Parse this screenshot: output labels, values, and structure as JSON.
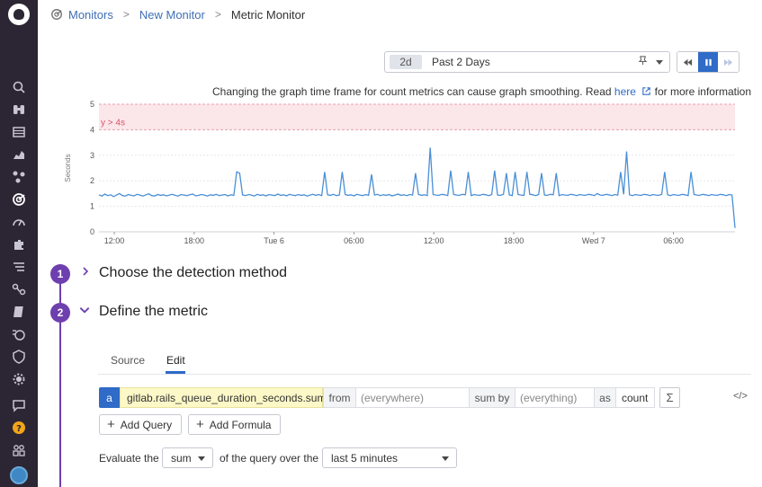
{
  "sidebar": {
    "icons": [
      "datadog-logo-icon",
      "search-icon",
      "binoculars-icon",
      "dashboard-icon",
      "chart-icon",
      "infrastructure-icon",
      "monitors-icon",
      "apm-gauge-icon",
      "integrations-icon",
      "logs-icon",
      "network-icon",
      "notebook-icon",
      "synthetics-icon",
      "security-icon",
      "settings-gear-icon",
      "chat-icon",
      "help-icon",
      "teams-icon",
      "user-avatar"
    ]
  },
  "breadcrumb": {
    "items": [
      "Monitors",
      "New Monitor",
      "Metric Monitor"
    ],
    "separator": ">"
  },
  "timeframe": {
    "badge": "2d",
    "label": "Past 2 Days"
  },
  "notice": {
    "before": "Changing the graph time frame for count metrics can cause graph smoothing. Read ",
    "link": "here",
    "after": " for more information"
  },
  "chart_data": {
    "type": "line",
    "ylabel": "Seconds",
    "ylim": [
      0,
      5
    ],
    "yticks": [
      "0",
      "1",
      "2",
      "3",
      "4",
      "5"
    ],
    "xticks": [
      "12:00",
      "18:00",
      "Tue 6",
      "06:00",
      "12:00",
      "18:00",
      "Wed 7",
      "06:00"
    ],
    "threshold": {
      "label": "y > 4s",
      "value": 4
    },
    "series": [
      {
        "color": "#4a8fd6",
        "values": [
          1.45,
          1.4,
          1.48,
          1.42,
          1.45,
          1.38,
          1.44,
          1.5,
          1.42,
          1.4,
          1.46,
          1.43,
          1.41,
          1.47,
          1.44,
          1.4,
          1.45,
          1.49,
          1.42,
          1.4,
          1.46,
          1.43,
          1.45,
          1.41,
          1.44,
          1.47,
          1.43,
          1.4,
          1.46,
          1.44,
          1.42,
          1.45,
          1.48,
          1.41,
          1.43,
          1.46,
          1.44,
          1.4,
          1.45,
          1.43,
          1.47,
          1.42,
          1.44,
          1.46,
          1.41,
          1.45,
          1.43,
          2.35,
          2.3,
          1.45,
          1.42,
          1.46,
          1.44,
          1.4,
          1.47,
          1.43,
          1.45,
          1.41,
          1.46,
          1.44,
          1.42,
          1.48,
          1.43,
          1.45,
          1.41,
          1.47,
          1.44,
          1.42,
          1.46,
          1.43,
          1.45,
          1.4,
          1.44,
          1.47,
          1.43,
          1.46,
          1.42,
          2.35,
          1.45,
          1.43,
          1.47,
          1.42,
          1.44,
          2.35,
          1.46,
          1.43,
          1.45,
          1.41,
          1.47,
          1.44,
          1.42,
          1.46,
          1.43,
          2.25,
          1.44,
          1.47,
          1.42,
          1.45,
          1.43,
          1.46,
          1.41,
          1.44,
          1.48,
          1.43,
          1.45,
          1.42,
          1.46,
          1.44,
          2.3,
          1.47,
          1.43,
          1.45,
          1.42,
          3.3,
          1.46,
          1.44,
          1.43,
          1.47,
          1.45,
          1.42,
          2.4,
          1.46,
          1.44,
          1.43,
          1.47,
          1.45,
          2.35,
          1.42,
          1.46,
          1.44,
          1.43,
          1.47,
          1.45,
          1.42,
          1.46,
          2.4,
          1.44,
          1.43,
          1.47,
          2.3,
          1.45,
          1.42,
          2.35,
          1.46,
          1.44,
          1.43,
          2.35,
          1.47,
          1.45,
          1.42,
          1.46,
          2.3,
          1.44,
          1.43,
          1.47,
          1.45,
          2.3,
          1.42,
          1.46,
          1.44,
          1.43,
          1.47,
          1.45,
          1.42,
          1.46,
          1.44,
          1.43,
          1.47,
          1.45,
          1.42,
          1.5,
          1.44,
          1.43,
          1.47,
          1.45,
          1.42,
          1.46,
          1.44,
          2.35,
          1.47,
          3.15,
          1.45,
          1.42,
          1.46,
          1.44,
          1.43,
          1.47,
          1.45,
          1.42,
          1.46,
          1.44,
          1.43,
          1.47,
          2.35,
          1.45,
          1.42,
          1.46,
          1.44,
          1.43,
          1.47,
          1.45,
          1.42,
          2.35,
          1.46,
          1.44,
          1.43,
          1.47,
          1.45,
          1.42,
          1.46,
          1.44,
          1.43,
          1.47,
          1.45,
          1.42,
          1.46,
          1.44,
          0.15
        ]
      }
    ],
    "grid": true
  },
  "steps": [
    {
      "number": "1",
      "title": "Choose the detection method",
      "expanded": false
    },
    {
      "number": "2",
      "title": "Define the metric",
      "expanded": true
    }
  ],
  "tabs": [
    "Source",
    "Edit"
  ],
  "query": {
    "letter": "a",
    "metric": "gitlab.rails_queue_duration_seconds.sum",
    "from_label": "from",
    "from_placeholder": "(everywhere)",
    "sumby_label": "sum by",
    "sumby_placeholder": "(everything)",
    "as_label": "as",
    "as_value": "count",
    "sigma": "Σ",
    "code": "</>"
  },
  "buttons": {
    "add_query": "Add Query",
    "add_formula": "Add Formula"
  },
  "evaluate": {
    "prefix": "Evaluate the",
    "aggregation": "sum",
    "middle": "of the query over the",
    "window": "last 5 minutes"
  }
}
